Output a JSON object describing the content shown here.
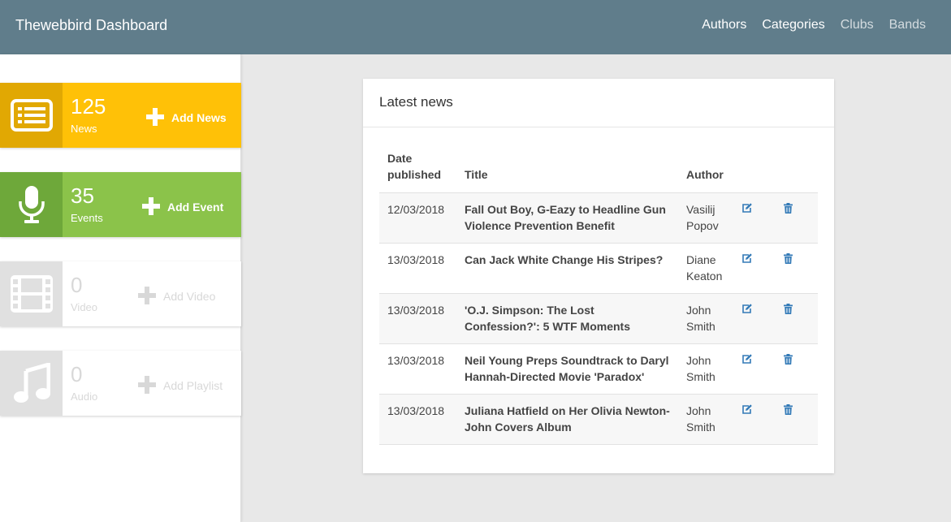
{
  "header": {
    "brand": "Thewebbird Dashboard",
    "nav": [
      "Authors",
      "Categories",
      "Clubs",
      "Bands"
    ]
  },
  "sidebar": {
    "tiles": [
      {
        "count": "125",
        "label": "News",
        "action": "Add News",
        "icon": "newspaper-icon",
        "color": "#ffc107",
        "icon_bg": "#e1a803"
      },
      {
        "count": "35",
        "label": "Events",
        "action": "Add Event",
        "icon": "microphone-icon",
        "color": "#8bc34a",
        "icon_bg": "#6ea83a"
      },
      {
        "count": "0",
        "label": "Video",
        "action": "Add Video",
        "icon": "film-icon",
        "color": "#e0e0e0"
      },
      {
        "count": "0",
        "label": "Audio",
        "action": "Add Playlist",
        "icon": "music-note-icon",
        "color": "#e0e0e0"
      }
    ]
  },
  "news_card": {
    "title": "Latest news",
    "columns": [
      "Date published",
      "Title",
      "Author"
    ],
    "rows": [
      {
        "date": "12/03/2018",
        "title": "Fall Out Boy, G-Eazy to Headline Gun Violence Prevention Benefit",
        "author": "Vasilij Popov"
      },
      {
        "date": "13/03/2018",
        "title": "Can Jack White Change His Stripes?",
        "author": "Diane Keaton"
      },
      {
        "date": "13/03/2018",
        "title": "'O.J. Simpson: The Lost Confession?': 5 WTF Moments",
        "author": "John Smith"
      },
      {
        "date": "13/03/2018",
        "title": "Neil Young Preps Soundtrack to Daryl Hannah-Directed Movie 'Paradox'",
        "author": "John Smith"
      },
      {
        "date": "13/03/2018",
        "title": "Juliana Hatfield on Her Olivia Newton-John Covers Album",
        "author": "John Smith"
      }
    ],
    "row_icons": [
      "edit-icon",
      "trash-icon"
    ],
    "icon_color": "#337ab7"
  }
}
